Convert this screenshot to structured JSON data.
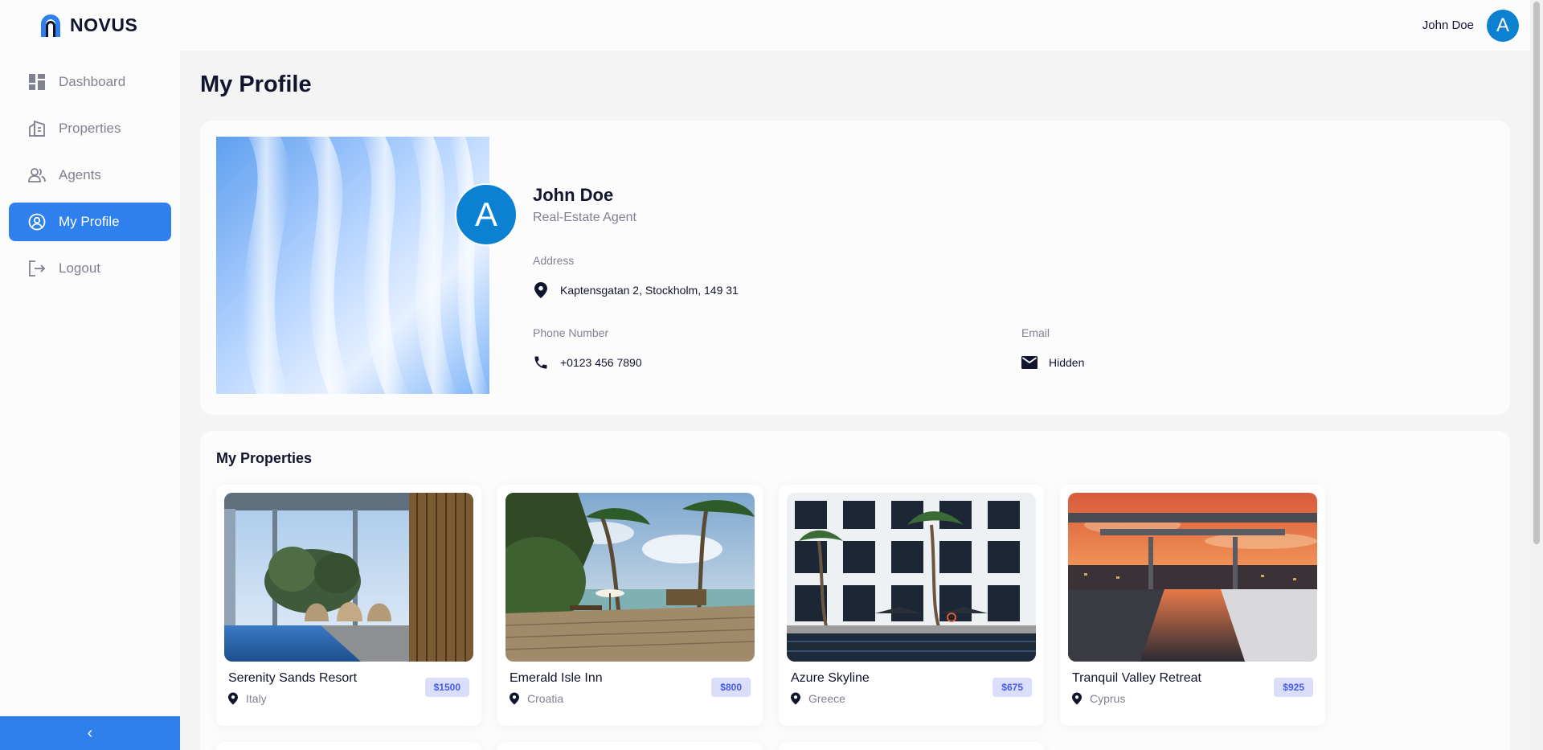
{
  "brand": {
    "name": "NOVUS"
  },
  "header": {
    "user_name": "John Doe",
    "avatar_initial": "A"
  },
  "sidebar": {
    "items": [
      {
        "label": "Dashboard",
        "icon": "dashboard-icon"
      },
      {
        "label": "Properties",
        "icon": "properties-icon"
      },
      {
        "label": "Agents",
        "icon": "agents-icon"
      },
      {
        "label": "My Profile",
        "icon": "profile-icon",
        "active": true
      },
      {
        "label": "Logout",
        "icon": "logout-icon"
      }
    ],
    "collapse_glyph": "‹"
  },
  "page": {
    "title": "My Profile"
  },
  "profile": {
    "avatar_initial": "A",
    "name": "John Doe",
    "role": "Real-Estate Agent",
    "address_label": "Address",
    "address": "Kaptensgatan 2, Stockholm, 149 31",
    "phone_label": "Phone Number",
    "phone": "+0123 456 7890",
    "email_label": "Email",
    "email": "Hidden"
  },
  "properties": {
    "title": "My Properties",
    "items": [
      {
        "name": "Serenity Sands Resort",
        "location": "Italy",
        "price": "$1500"
      },
      {
        "name": "Emerald Isle Inn",
        "location": "Croatia",
        "price": "$800"
      },
      {
        "name": "Azure Skyline",
        "location": "Greece",
        "price": "$675"
      },
      {
        "name": "Tranquil Valley Retreat",
        "location": "Cyprus",
        "price": "$925"
      }
    ]
  },
  "colors": {
    "accent": "#2f80ed",
    "avatar": "#0c81d1",
    "price_bg": "#dadefa",
    "price_text": "#475be8"
  }
}
